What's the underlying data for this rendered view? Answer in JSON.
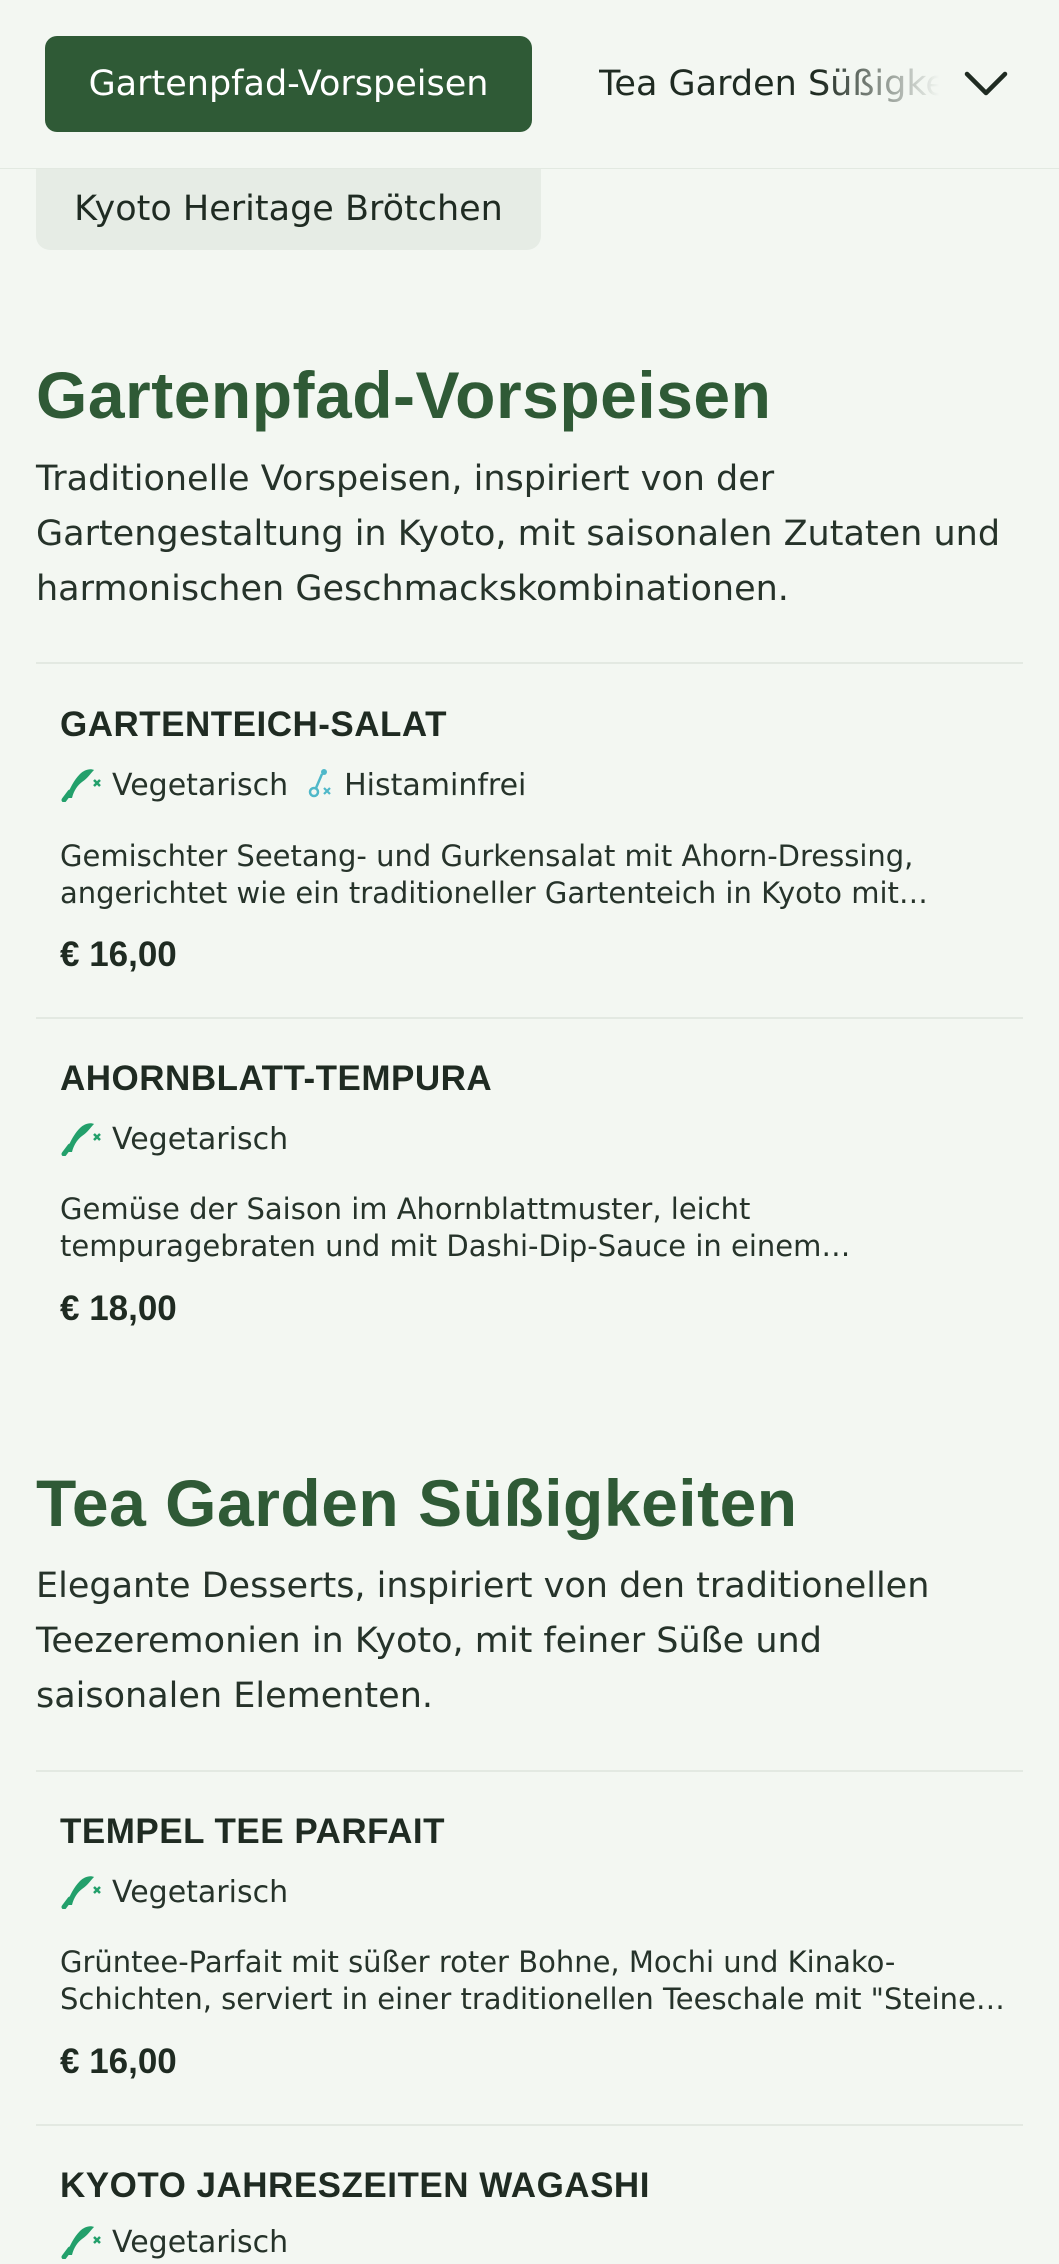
{
  "nav": {
    "active_tab": "Gartenpfad-Vorspeisen",
    "next_tab": "Tea Garden Süßigkeiten",
    "prev_tab": "Kyoto Heritage Brötchen"
  },
  "colors": {
    "primary": "#2f5a36",
    "background": "#f3f7f2",
    "vegetarian_icon": "#22a06b",
    "histamine_icon": "#4fb8c9"
  },
  "sections": [
    {
      "title": "Gartenpfad-Vorspeisen",
      "description": "Traditionelle Vorspeisen, inspiriert von der Gartengestaltung in Kyoto, mit saisonalen Zutaten und harmonischen Geschmackskombinationen.",
      "items": [
        {
          "name": "GARTENTEICH-SALAT",
          "tags": [
            {
              "icon": "vegetarian-icon",
              "label": "Vegetarisch"
            },
            {
              "icon": "histamine-free-icon",
              "label": "Histaminfrei"
            }
          ],
          "description": "Gemischter Seetang- und Gurkensalat mit Ahorn-Dressing, angerichtet wie ein traditioneller Gartenteich in Kyoto mit \"Stein\"-Arrangements aus geröstetem Tofu.",
          "price": "€ 16,00"
        },
        {
          "name": "AHORNBLATT-TEMPURA",
          "tags": [
            {
              "icon": "vegetarian-icon",
              "label": "Vegetarisch"
            }
          ],
          "description": "Gemüse der Saison im Ahornblattmuster, leicht tempuragebraten und mit Dashi-Dip-Sauce in einem traditionellen Keramikgefäß serviert.",
          "price": "€ 18,00"
        }
      ]
    },
    {
      "title": "Tea Garden Süßigkeiten",
      "description": "Elegante Desserts, inspiriert von den traditionellen Teezeremonien in Kyoto, mit feiner Süße und saisonalen Elementen.",
      "items": [
        {
          "name": "TEMPEL TEE PARFAIT",
          "tags": [
            {
              "icon": "vegetarian-icon",
              "label": "Vegetarisch"
            }
          ],
          "description": "Grüntee-Parfait mit süßer roter Bohne, Mochi und Kinako-Schichten, serviert in einer traditionellen Teeschale mit \"Steinen\" aus Sesam-Crunch.",
          "price": "€ 16,00"
        },
        {
          "name": "KYOTO JAHRESZEITEN WAGASHI",
          "tags": [
            {
              "icon": "vegetarian-icon",
              "label": "Vegetarisch"
            }
          ]
        }
      ]
    }
  ]
}
